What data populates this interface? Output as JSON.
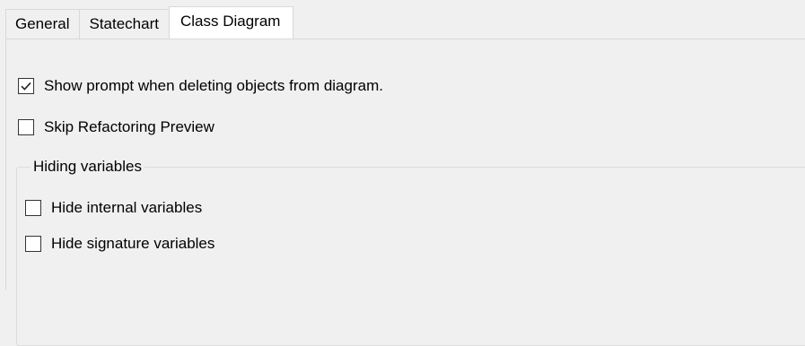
{
  "tabs": [
    {
      "label": "General",
      "selected": false
    },
    {
      "label": "Statechart",
      "selected": false
    },
    {
      "label": "Class Diagram",
      "selected": true
    }
  ],
  "options": {
    "show_prompt": {
      "label": "Show prompt when deleting objects from diagram.",
      "checked": true
    },
    "skip_refactoring": {
      "label": "Skip Refactoring Preview",
      "checked": false
    }
  },
  "hiding_group": {
    "title": "Hiding variables",
    "hide_internal": {
      "label": "Hide internal variables",
      "checked": false
    },
    "hide_signature": {
      "label": "Hide signature variables",
      "checked": false
    }
  },
  "icons": {
    "check": "checkmark-icon"
  }
}
